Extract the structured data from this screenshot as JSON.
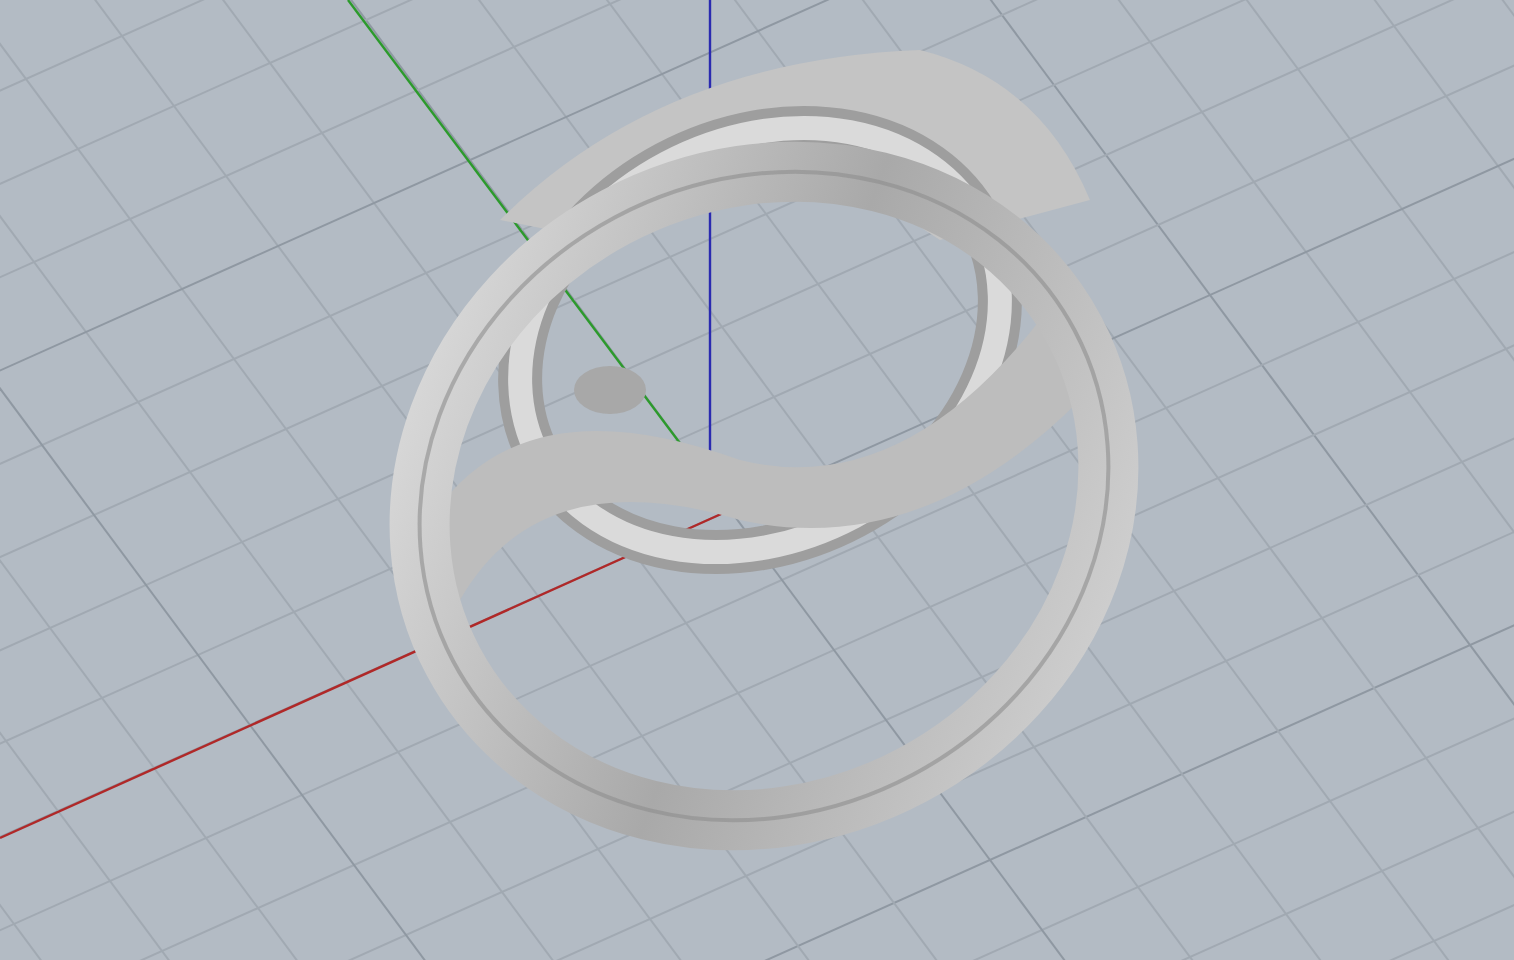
{
  "viewport": {
    "grid": true,
    "axes": true,
    "object": {
      "kind": "ring"
    }
  }
}
